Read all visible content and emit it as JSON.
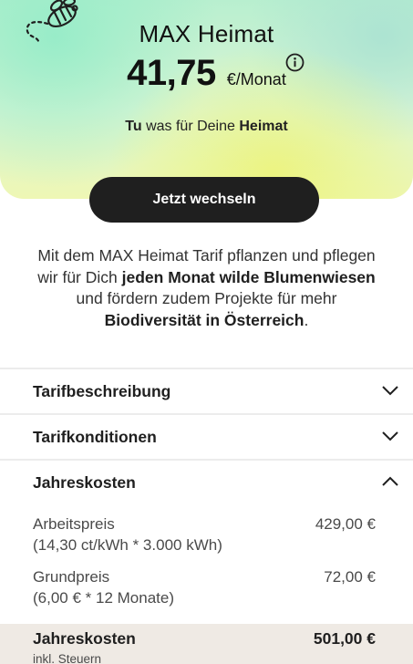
{
  "hero": {
    "title": "MAX Heimat",
    "price": "41,75",
    "unit": "€/Monat",
    "slogan_part1": "Tu",
    "slogan_part2": " was für Deine ",
    "slogan_part3": "Heimat",
    "icon": "bee-icon",
    "info_icon": "info-icon",
    "background_colors": [
      "#b8efcf",
      "#dcf6d6",
      "#eef7b4"
    ]
  },
  "cta": {
    "label": "Jetzt wechseln",
    "color": "#1f1f1f"
  },
  "description": {
    "t1": "Mit dem MAX Heimat Tarif pflanzen und pflegen wir für Dich ",
    "b1": "jeden Monat wilde Blumenwiesen",
    "t2": " und fördern zudem Projekte für mehr ",
    "b2": "Biodiversität in Österreich",
    "t3": "."
  },
  "accordion": [
    {
      "label": "Tarifbeschreibung",
      "expanded": false,
      "icon": "chevron-down-icon"
    },
    {
      "label": "Tarifkonditionen",
      "expanded": false,
      "icon": "chevron-down-icon"
    },
    {
      "label": "Jahreskosten",
      "expanded": true,
      "icon": "chevron-up-icon"
    }
  ],
  "costs": [
    {
      "label": "Arbeitspreis",
      "detail": "(14,30 ct/kWh * 3.000 kWh)",
      "amount": "429,00 €"
    },
    {
      "label": "Grundpreis",
      "detail": "(6,00 € * 12 Monate)",
      "amount": "72,00 €"
    }
  ],
  "total": {
    "label": "Jahreskosten",
    "amount": "501,00 €",
    "note": "inkl. Steuern",
    "background": "#efeae4"
  }
}
